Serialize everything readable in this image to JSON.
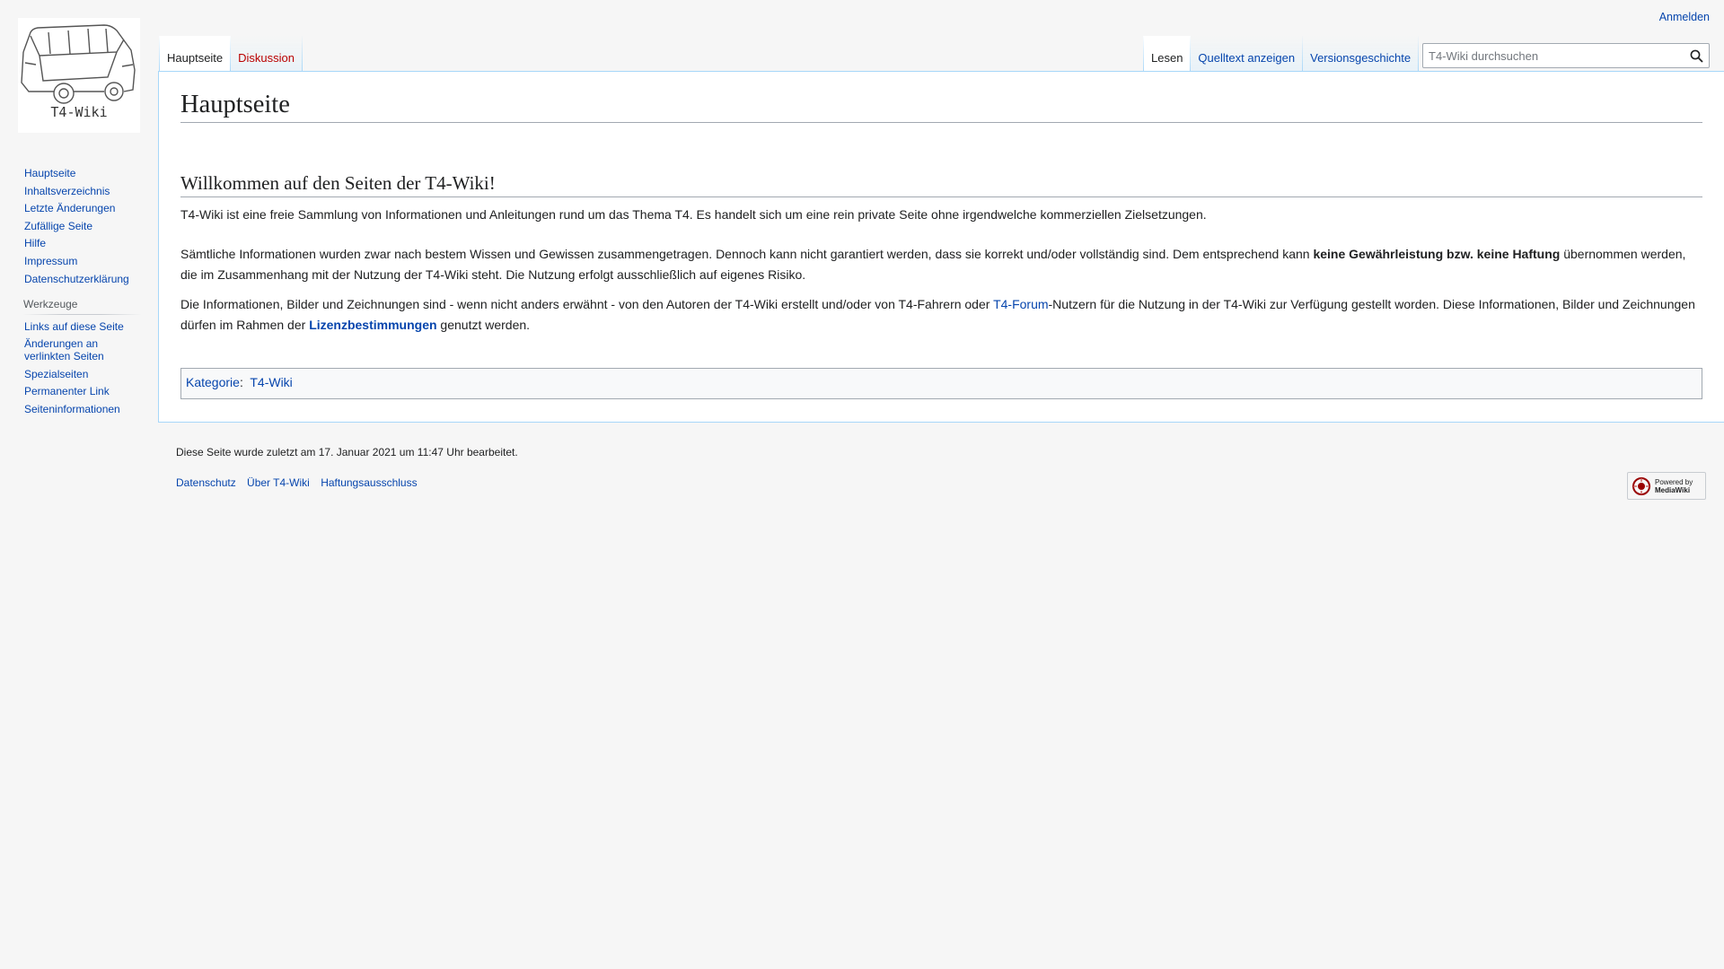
{
  "personal": {
    "login": "Anmelden"
  },
  "logo": {
    "text": "T4-Wiki"
  },
  "tabs_left": [
    {
      "label": "Hauptseite",
      "selected": true
    },
    {
      "label": "Diskussion",
      "selected": false
    }
  ],
  "tabs_right": [
    {
      "label": "Lesen",
      "selected": true
    },
    {
      "label": "Quelltext anzeigen",
      "selected": false
    },
    {
      "label": "Versionsgeschichte",
      "selected": false
    }
  ],
  "search": {
    "placeholder": "T4-Wiki durchsuchen"
  },
  "content": {
    "title": "Hauptseite",
    "welcome_heading": "Willkommen auf den Seiten der T4-Wiki!",
    "p1": "T4-Wiki ist eine freie Sammlung von Informationen und Anleitungen rund um das Thema T4. Es handelt sich um eine rein private Seite ohne irgendwelche kommerziellen Zielsetzungen.",
    "p2_a": "Sämtliche Informationen wurden zwar nach bestem Wissen und Gewissen zusammengetragen. Dennoch kann nicht garantiert werden, dass sie korrekt und/oder vollständig sind. Dem entsprechend kann ",
    "p2_bold": "keine Gewährleistung bzw. keine Haftung",
    "p2_b": " übernommen werden, die im Zusammenhang mit der Nutzung der T4-Wiki steht. Die Nutzung erfolgt ausschließlich auf eigenes Risiko.",
    "p3_a": "Die Informationen, Bilder und Zeichnungen sind - wenn nicht anders erwähnt - von den Autoren der T4-Wiki erstellt und/oder von T4-Fahrern oder ",
    "p3_link": "T4-Forum",
    "p3_b": "-Nutzern für die Nutzung in der T4-Wiki zur Verfügung gestellt worden. Diese Informationen, Bilder und Zeichnungen dürfen im Rahmen der ",
    "p3_link2": "Lizenzbestimmungen",
    "p3_c": " genutzt werden.",
    "category_label": "Kategorie",
    "category_sep": ":",
    "category_value": "T4-Wiki"
  },
  "sidebar": {
    "navigation": [
      "Hauptseite",
      "Inhaltsverzeichnis",
      "Letzte Änderungen",
      "Zufällige Seite",
      "Hilfe",
      "Impressum",
      "Datenschutzerklärung"
    ],
    "tools_heading": "Werkzeuge",
    "tools": [
      "Links auf diese Seite",
      "Änderungen an verlinkten Seiten",
      "Spezialseiten",
      "Permanenter Link",
      "Seiteninformationen"
    ]
  },
  "footer": {
    "lastmod": "Diese Seite wurde zuletzt am 17. Januar 2021 um 11:47 Uhr bearbeitet.",
    "links": [
      "Datenschutz",
      "Über T4-Wiki",
      "Haftungsausschluss"
    ],
    "powered_line1": "Powered by",
    "powered_line2": "MediaWiki"
  },
  "colors": {
    "link": "#0645ad",
    "new_link": "#ba0000",
    "border": "#a7d7f9"
  }
}
